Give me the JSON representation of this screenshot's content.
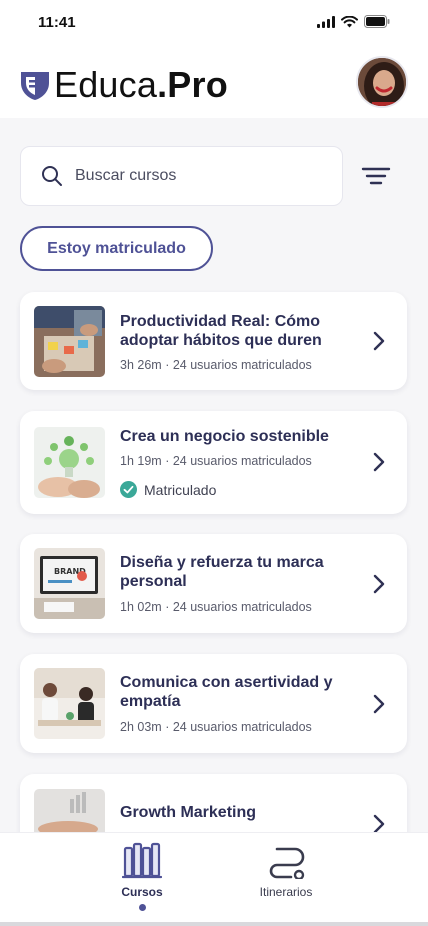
{
  "status_bar": {
    "time": "11:41"
  },
  "header": {
    "logo_main": "Educa",
    "logo_dot": ".",
    "logo_bold": "Pro"
  },
  "search": {
    "placeholder": "Buscar cursos"
  },
  "filter_chip": {
    "label": "Estoy matriculado"
  },
  "colors": {
    "accent": "#4f5296",
    "title": "#2d2f56",
    "check": "#3aa898"
  },
  "courses": [
    {
      "title": "Productividad Real: Cómo adoptar hábitos que duren",
      "duration": "3h 26m",
      "separator": "·",
      "students": "24 usuarios matriculados",
      "enrolled_label": ""
    },
    {
      "title": "Crea un negocio sostenible",
      "duration": "1h 19m",
      "separator": "·",
      "students": "24 usuarios matriculados",
      "enrolled_label": "Matriculado"
    },
    {
      "title": "Diseña y refuerza tu marca personal",
      "duration": "1h 02m",
      "separator": "·",
      "students": "24 usuarios matriculados",
      "enrolled_label": ""
    },
    {
      "title": "Comunica con asertividad y empatía",
      "duration": "2h 03m",
      "separator": "·",
      "students": "24 usuarios matriculados",
      "enrolled_label": ""
    },
    {
      "title": "Growth Marketing",
      "duration": "",
      "separator": "",
      "students": "",
      "enrolled_label": ""
    }
  ],
  "tabs": [
    {
      "label": "Cursos",
      "icon": "books-icon",
      "active": true
    },
    {
      "label": "Itinerarios",
      "icon": "route-icon",
      "active": false
    }
  ]
}
